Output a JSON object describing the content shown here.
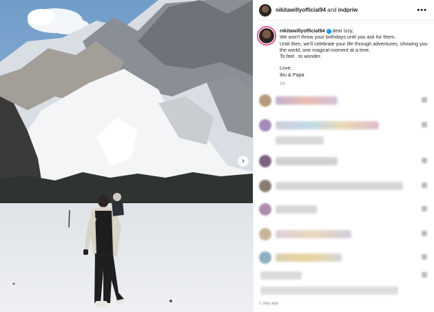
{
  "header": {
    "user": "nikitawillyofficial94",
    "conjunction": "and",
    "collaborator": "indpriw",
    "more_icon": "ellipsis-icon"
  },
  "caption": {
    "user": "nikitawillyofficial94",
    "greeting": "dear Izzy,",
    "lines": [
      "We won't throw your birthdays until you ask for them.",
      "Until then, we'll celebrate your life through adventures, showing you the world, one magical moment at a time.",
      "To feel . to wonder.",
      "Love,",
      "Ibu & Papa"
    ],
    "age": "1d"
  },
  "footer": {
    "timestamp": "1 day ago"
  },
  "colors": {
    "story_ring": "#d62976",
    "verified": "#0095f6",
    "muted_text": "#8e8e8e"
  }
}
